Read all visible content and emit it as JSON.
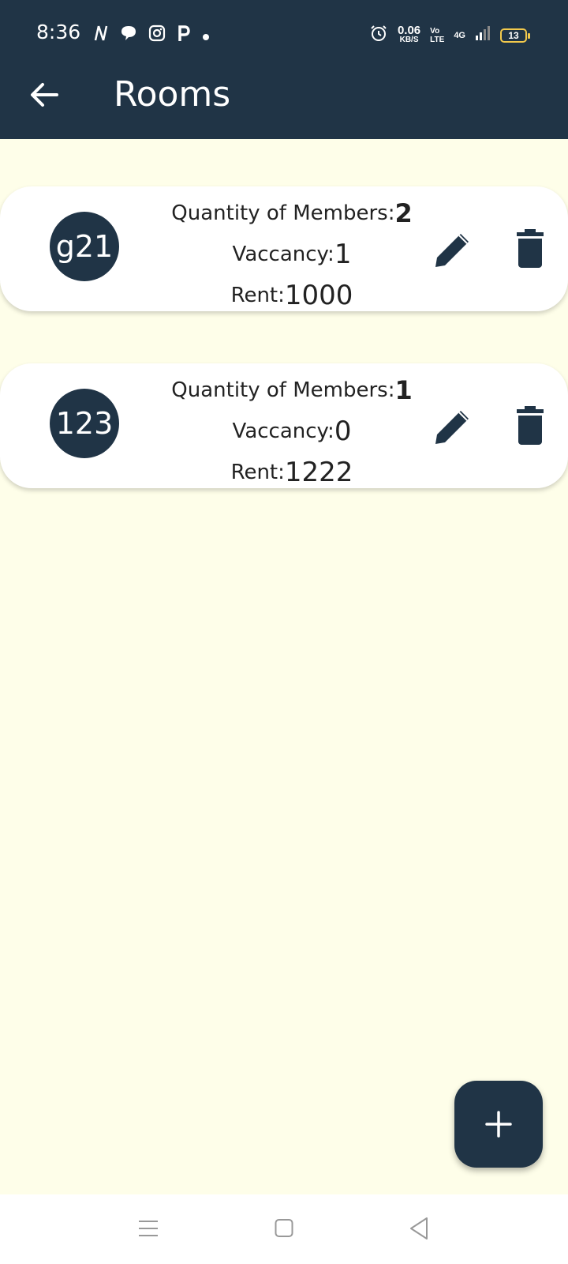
{
  "status_bar": {
    "time": "8:36",
    "speed_value": "0.06",
    "speed_unit": "KB/S",
    "volte_top": "Vo",
    "volte_bottom": "LTE",
    "network": "4G",
    "battery": "13",
    "icons_left": [
      "n-icon",
      "chat-icon",
      "instagram-icon",
      "p-icon",
      "dot-icon"
    ],
    "icons_right": [
      "alarm-icon",
      "signal-icon",
      "battery-icon"
    ]
  },
  "app_bar": {
    "title": "Rooms",
    "back_icon": "arrow-left-icon"
  },
  "rooms": [
    {
      "name": "g21",
      "members_label": "Quantity of Members:",
      "members": "2",
      "vacancy_label": "Vaccancy:",
      "vacancy": "1",
      "rent_label": "Rent:",
      "rent": "1000"
    },
    {
      "name": "123",
      "members_label": "Quantity of Members:",
      "members": "1",
      "vacancy_label": "Vaccancy:",
      "vacancy": "0",
      "rent_label": "Rent:",
      "rent": "1222"
    }
  ],
  "fab": {
    "icon": "plus-icon"
  },
  "nav": {
    "icons": [
      "menu-icon",
      "home-square-icon",
      "back-triangle-icon"
    ]
  },
  "colors": {
    "primary": "#203446",
    "background": "#fefee9",
    "card": "#ffffff"
  }
}
